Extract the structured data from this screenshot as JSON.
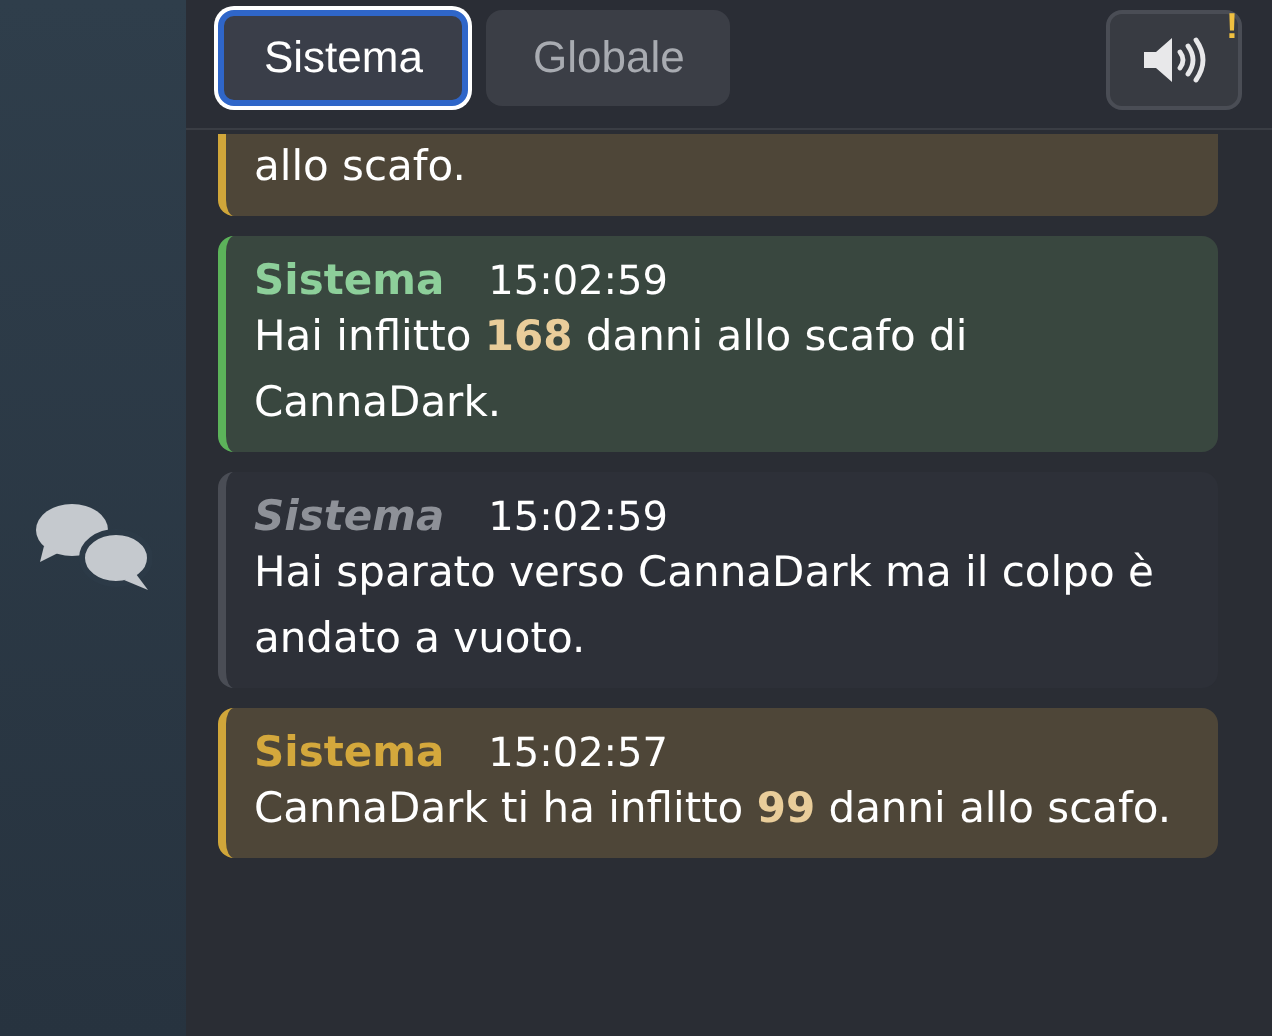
{
  "tabs": [
    {
      "label": "Sistema",
      "selected": true
    },
    {
      "label": "Globale",
      "selected": false
    }
  ],
  "sound_button": {
    "badge": "!"
  },
  "messages": [
    {
      "kind": "damage_taken",
      "text": "allo scafo."
    },
    {
      "kind": "damage_dealt",
      "sender": "Sistema",
      "time": "15:02:59",
      "text": "Hai inflitto **168** danni allo scafo di CannaDark."
    },
    {
      "kind": "miss",
      "sender": "Sistema",
      "time": "15:02:59",
      "text": "Hai sparato verso CannaDark ma il colpo è andato a vuoto."
    },
    {
      "kind": "damage_taken",
      "sender": "Sistema",
      "time": "15:02:57",
      "text": "CannaDark ti ha inflitto **99** danni allo scafo."
    }
  ]
}
